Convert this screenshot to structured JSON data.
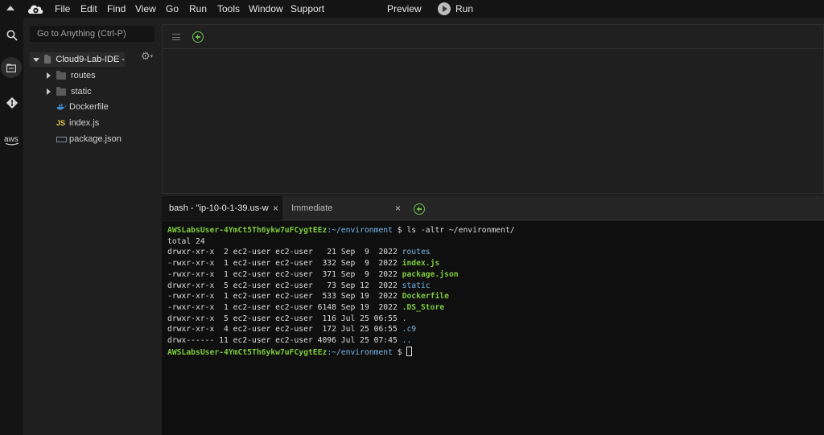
{
  "menubar": {
    "items": [
      "File",
      "Edit",
      "Find",
      "View",
      "Go",
      "Run",
      "Tools",
      "Window",
      "Support"
    ],
    "preview": "Preview",
    "run": "Run"
  },
  "activity": {
    "aws_label": "aws"
  },
  "filetree": {
    "goto_placeholder": "Go to Anything (Ctrl-P)",
    "root": "Cloud9-Lab-IDE -",
    "items": [
      {
        "name": "routes",
        "type": "folder"
      },
      {
        "name": "static",
        "type": "folder"
      },
      {
        "name": "Dockerfile",
        "type": "docker"
      },
      {
        "name": "index.js",
        "type": "js"
      },
      {
        "name": "package.json",
        "type": "json"
      }
    ]
  },
  "terminal": {
    "tabs": [
      {
        "label": "bash - \"ip-10-0-1-39.us-w",
        "close": "×"
      },
      {
        "label": "Immediate",
        "close": "×"
      }
    ],
    "prompt_user": "AWSLabsUser-4YmCt5Th6ykw7uFCygtEEz",
    "prompt_path": ":~/environment",
    "command": " $ ls -altr ~/environment/",
    "total": "total 24",
    "rows": [
      {
        "meta": "drwxr-xr-x  2 ec2-user ec2-user   21 Sep  9  2022 ",
        "name": "routes",
        "kind": "dir"
      },
      {
        "meta": "-rwxr-xr-x  1 ec2-user ec2-user  332 Sep  9  2022 ",
        "name": "index.js",
        "kind": "file"
      },
      {
        "meta": "-rwxr-xr-x  1 ec2-user ec2-user  371 Sep  9  2022 ",
        "name": "package.json",
        "kind": "file"
      },
      {
        "meta": "drwxr-xr-x  5 ec2-user ec2-user   73 Sep 12  2022 ",
        "name": "static",
        "kind": "dir"
      },
      {
        "meta": "-rwxr-xr-x  1 ec2-user ec2-user  533 Sep 19  2022 ",
        "name": "Dockerfile",
        "kind": "file"
      },
      {
        "meta": "-rwxr-xr-x  1 ec2-user ec2-user 6148 Sep 19  2022 ",
        "name": ".DS_Store",
        "kind": "file"
      },
      {
        "meta": "drwxr-xr-x  5 ec2-user ec2-user  116 Jul 25 06:55 ",
        "name": ".",
        "kind": "dir"
      },
      {
        "meta": "drwxr-xr-x  4 ec2-user ec2-user  172 Jul 25 06:55 ",
        "name": ".c9",
        "kind": "dir"
      },
      {
        "meta": "drwx------ 11 ec2-user ec2-user 4096 Jul 25 07:45 ",
        "name": "..",
        "kind": "dir"
      }
    ],
    "prompt2_path": ":~/environment",
    "prompt2_tail": " $ "
  },
  "colors": {
    "accent_green": "#6cc04a",
    "dir_blue": "#78b7e8",
    "file_green": "#7dcb3c"
  }
}
